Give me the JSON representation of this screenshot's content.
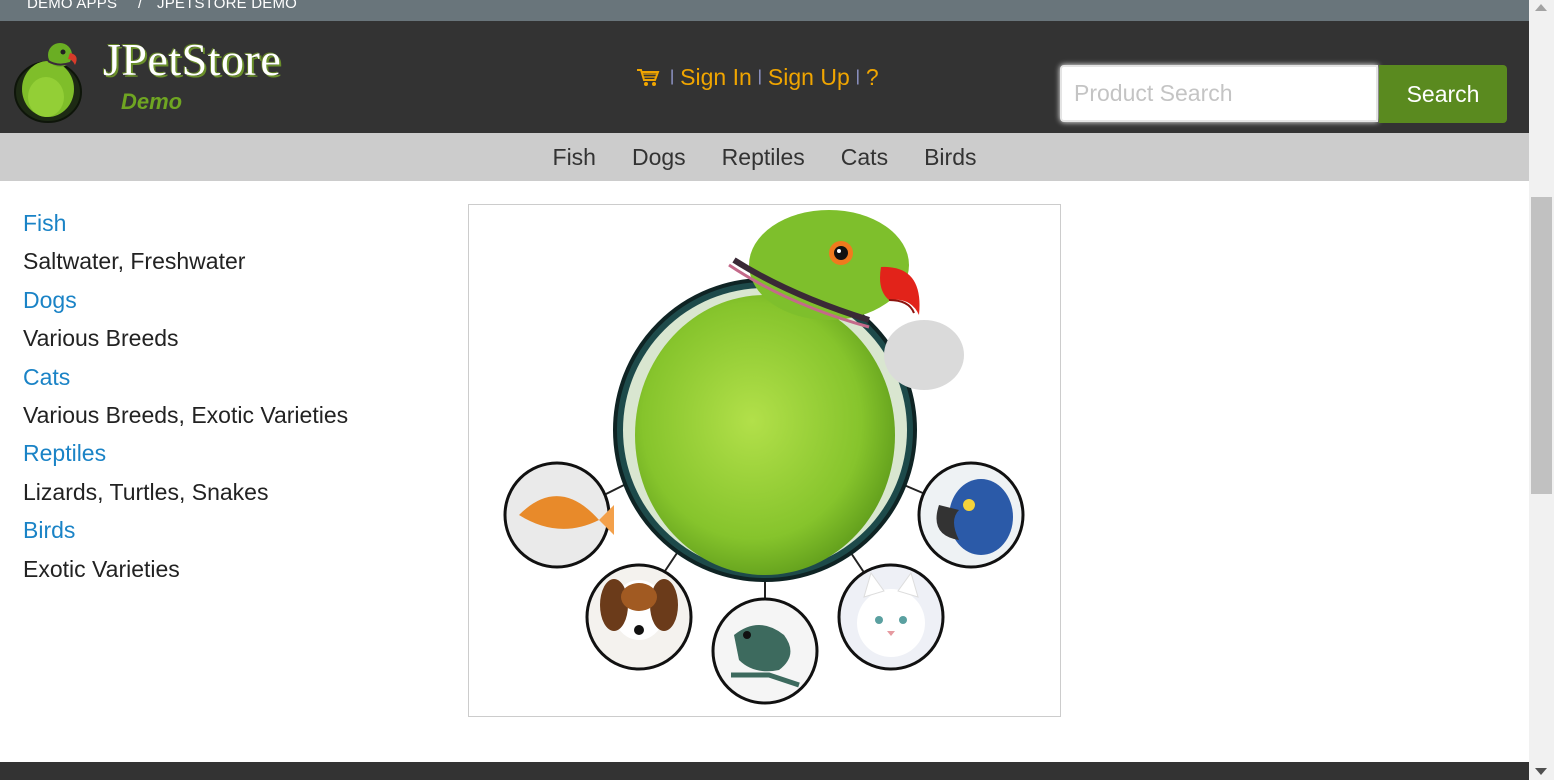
{
  "breadcrumb": {
    "item1": "DEMO APPS",
    "separator": "/",
    "item2": "JPETSTORE DEMO"
  },
  "header": {
    "brand_title": "JPetStore",
    "brand_subtitle": "Demo",
    "logo_icon": "parrot-logo-icon",
    "cart_icon": "shopping-cart-icon",
    "sign_in": "Sign In",
    "sign_up": "Sign Up",
    "help": "?",
    "separator": "|"
  },
  "search": {
    "placeholder": "Product Search",
    "value": "",
    "button_label": "Search"
  },
  "nav": {
    "items": [
      "Fish",
      "Dogs",
      "Reptiles",
      "Cats",
      "Birds"
    ]
  },
  "sidebar": {
    "items": [
      {
        "label": "Fish",
        "desc": "Saltwater, Freshwater"
      },
      {
        "label": "Dogs",
        "desc": "Various Breeds"
      },
      {
        "label": "Cats",
        "desc": "Various Breeds, Exotic Varieties"
      },
      {
        "label": "Reptiles",
        "desc": "Lizards, Turtles, Snakes"
      },
      {
        "label": "Birds",
        "desc": "Exotic Varieties"
      }
    ]
  },
  "main_image": {
    "icon": "pet-categories-image",
    "hotspots": [
      "fish",
      "dog",
      "reptile",
      "cat",
      "bird"
    ]
  },
  "colors": {
    "header_bg": "#333333",
    "crumb_bg": "#69757b",
    "nav_bg": "#cccccc",
    "link_blue": "#1a83c6",
    "account_orange": "#f0a500",
    "search_green": "#5a8a1f"
  }
}
